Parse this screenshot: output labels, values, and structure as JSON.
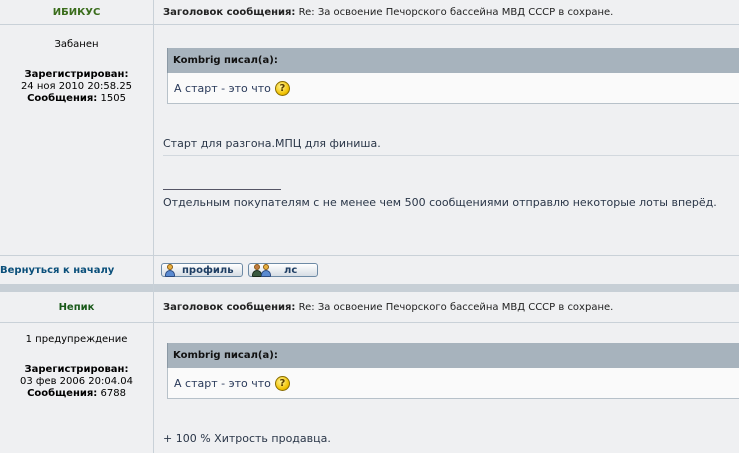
{
  "posts": [
    {
      "author": "ИБИКУС",
      "status": "Забанен",
      "registered_label": "Зарегистрирован:",
      "registered_date": "24 ноя 2010 20:58.25",
      "posts_label": "Сообщения:",
      "posts_count": "1505",
      "subject_label": "Заголовок сообщения:",
      "subject": "Re: За освоение Печорского бассейна МВД СССР в сохране.",
      "quote_author": "Kombrig писал(а):",
      "quote_text": "А старт - это что",
      "message": "Старт для разгона.МПЦ для финиша.",
      "signature": "Отдельным покупателям с не менее чем 500 сообщениями отправлю некоторые лоты вперёд.",
      "back_to_top": "Вернуться к началу",
      "profile_button": "профиль",
      "pm_button": "лс"
    },
    {
      "author": "Непик",
      "status": "1 предупреждение",
      "registered_label": "Зарегистрирован:",
      "registered_date": "03 фев 2006 20:04.04",
      "posts_label": "Сообщения:",
      "posts_count": "6788",
      "subject_label": "Заголовок сообщения:",
      "subject": "Re: За освоение Печорского бассейна МВД СССР в сохране.",
      "quote_author": "Kombrig писал(а):",
      "quote_text": "А старт - это что",
      "message": "+ 100 % Хитрость продавца."
    }
  ],
  "icons": {
    "question": "question-smiley-icon",
    "profile": "user-icon",
    "pm": "users-icon"
  },
  "colors": {
    "background": "#dee3e7",
    "cell": "#eff0f2",
    "quote_header": "#a7b3bd",
    "link": "#0a4f7a"
  }
}
